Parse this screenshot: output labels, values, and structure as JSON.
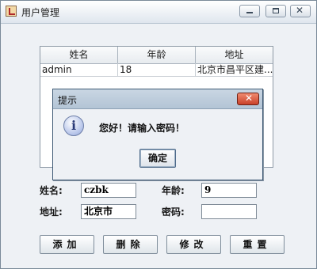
{
  "window": {
    "title": "用户管理",
    "controls": {
      "minimize": "minimize-icon",
      "maximize": "maximize-icon",
      "close": "close-icon"
    }
  },
  "table": {
    "columns": [
      "姓名",
      "年龄",
      "地址"
    ],
    "rows": [
      {
        "name": "admin",
        "age": "18",
        "address": "北京市昌平区建..."
      }
    ]
  },
  "form": {
    "name_label": "姓名:",
    "name_value": "czbk",
    "age_label": "年龄:",
    "age_value": "9",
    "address_label": "地址:",
    "address_value": "北京市",
    "password_label": "密码:",
    "password_value": ""
  },
  "buttons": {
    "add": "添加",
    "delete": "删除",
    "edit": "修改",
    "reset": "重置"
  },
  "dialog": {
    "title": "提示",
    "icon": "info-icon",
    "message": "您好！请输入密码！",
    "ok": "确定"
  }
}
